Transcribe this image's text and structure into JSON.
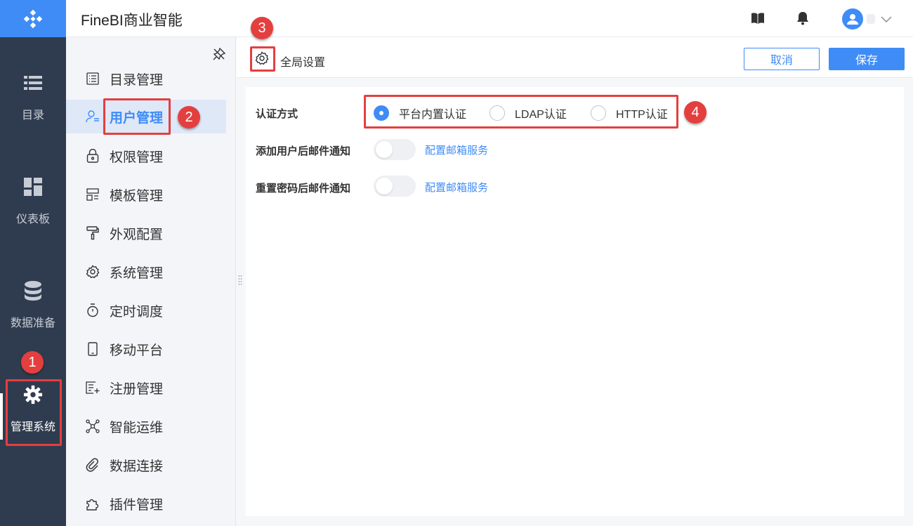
{
  "app": {
    "title": "FineBI商业智能"
  },
  "colors": {
    "accent": "#3f8cf7",
    "rail_bg": "#2f3c4f",
    "annotation": "#e43f3f"
  },
  "rail": {
    "items": [
      {
        "label": "目录",
        "icon": "list-icon"
      },
      {
        "label": "仪表板",
        "icon": "dashboard-icon"
      },
      {
        "label": "数据准备",
        "icon": "database-icon"
      },
      {
        "label": "管理系统",
        "icon": "gear-icon",
        "active": true
      }
    ]
  },
  "header": {
    "icons": [
      "book-icon",
      "bell-icon",
      "user-avatar-icon",
      "chevron-down-icon"
    ]
  },
  "subnav": {
    "items": [
      {
        "label": "目录管理",
        "icon": "catalog-icon"
      },
      {
        "label": "用户管理",
        "icon": "user-icon",
        "active": true
      },
      {
        "label": "权限管理",
        "icon": "lock-icon"
      },
      {
        "label": "模板管理",
        "icon": "template-icon"
      },
      {
        "label": "外观配置",
        "icon": "paint-roller-icon"
      },
      {
        "label": "系统管理",
        "icon": "gear-icon"
      },
      {
        "label": "定时调度",
        "icon": "timer-icon"
      },
      {
        "label": "移动平台",
        "icon": "mobile-icon"
      },
      {
        "label": "注册管理",
        "icon": "register-icon"
      },
      {
        "label": "智能运维",
        "icon": "network-icon"
      },
      {
        "label": "数据连接",
        "icon": "link-icon"
      },
      {
        "label": "插件管理",
        "icon": "plugin-icon"
      }
    ]
  },
  "toolbar": {
    "title": "全局设置",
    "cancel_label": "取消",
    "save_label": "保存"
  },
  "settings": {
    "auth": {
      "label": "认证方式",
      "options": [
        {
          "label": "平台内置认证",
          "checked": true
        },
        {
          "label": "LDAP认证",
          "checked": false
        },
        {
          "label": "HTTP认证",
          "checked": false
        }
      ]
    },
    "add_user_notify": {
      "label": "添加用户后邮件通知",
      "enabled": false,
      "link": "配置邮箱服务"
    },
    "reset_pwd_notify": {
      "label": "重置密码后邮件通知",
      "enabled": false,
      "link": "配置邮箱服务"
    }
  },
  "annotations": [
    "1",
    "2",
    "3",
    "4"
  ]
}
